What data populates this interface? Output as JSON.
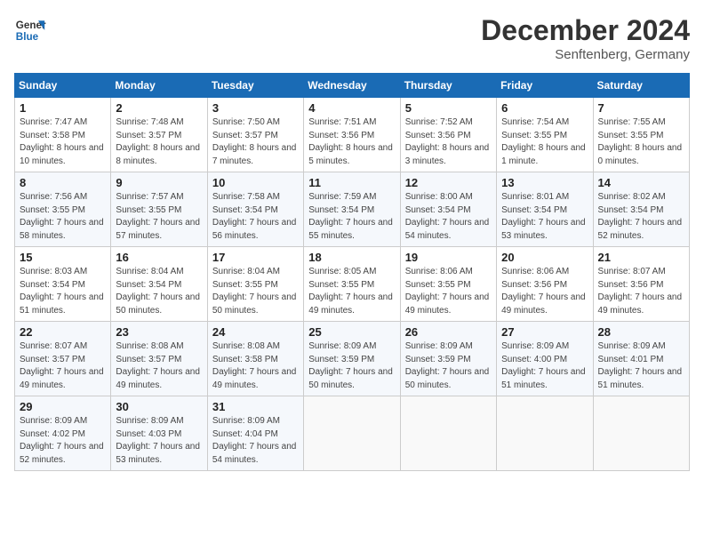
{
  "header": {
    "logo_line1": "General",
    "logo_line2": "Blue",
    "month_year": "December 2024",
    "location": "Senftenberg, Germany"
  },
  "weekdays": [
    "Sunday",
    "Monday",
    "Tuesday",
    "Wednesday",
    "Thursday",
    "Friday",
    "Saturday"
  ],
  "weeks": [
    [
      {
        "day": "1",
        "sunrise": "7:47 AM",
        "sunset": "3:58 PM",
        "daylight": "8 hours and 10 minutes."
      },
      {
        "day": "2",
        "sunrise": "7:48 AM",
        "sunset": "3:57 PM",
        "daylight": "8 hours and 8 minutes."
      },
      {
        "day": "3",
        "sunrise": "7:50 AM",
        "sunset": "3:57 PM",
        "daylight": "8 hours and 7 minutes."
      },
      {
        "day": "4",
        "sunrise": "7:51 AM",
        "sunset": "3:56 PM",
        "daylight": "8 hours and 5 minutes."
      },
      {
        "day": "5",
        "sunrise": "7:52 AM",
        "sunset": "3:56 PM",
        "daylight": "8 hours and 3 minutes."
      },
      {
        "day": "6",
        "sunrise": "7:54 AM",
        "sunset": "3:55 PM",
        "daylight": "8 hours and 1 minute."
      },
      {
        "day": "7",
        "sunrise": "7:55 AM",
        "sunset": "3:55 PM",
        "daylight": "8 hours and 0 minutes."
      }
    ],
    [
      {
        "day": "8",
        "sunrise": "7:56 AM",
        "sunset": "3:55 PM",
        "daylight": "7 hours and 58 minutes."
      },
      {
        "day": "9",
        "sunrise": "7:57 AM",
        "sunset": "3:55 PM",
        "daylight": "7 hours and 57 minutes."
      },
      {
        "day": "10",
        "sunrise": "7:58 AM",
        "sunset": "3:54 PM",
        "daylight": "7 hours and 56 minutes."
      },
      {
        "day": "11",
        "sunrise": "7:59 AM",
        "sunset": "3:54 PM",
        "daylight": "7 hours and 55 minutes."
      },
      {
        "day": "12",
        "sunrise": "8:00 AM",
        "sunset": "3:54 PM",
        "daylight": "7 hours and 54 minutes."
      },
      {
        "day": "13",
        "sunrise": "8:01 AM",
        "sunset": "3:54 PM",
        "daylight": "7 hours and 53 minutes."
      },
      {
        "day": "14",
        "sunrise": "8:02 AM",
        "sunset": "3:54 PM",
        "daylight": "7 hours and 52 minutes."
      }
    ],
    [
      {
        "day": "15",
        "sunrise": "8:03 AM",
        "sunset": "3:54 PM",
        "daylight": "7 hours and 51 minutes."
      },
      {
        "day": "16",
        "sunrise": "8:04 AM",
        "sunset": "3:54 PM",
        "daylight": "7 hours and 50 minutes."
      },
      {
        "day": "17",
        "sunrise": "8:04 AM",
        "sunset": "3:55 PM",
        "daylight": "7 hours and 50 minutes."
      },
      {
        "day": "18",
        "sunrise": "8:05 AM",
        "sunset": "3:55 PM",
        "daylight": "7 hours and 49 minutes."
      },
      {
        "day": "19",
        "sunrise": "8:06 AM",
        "sunset": "3:55 PM",
        "daylight": "7 hours and 49 minutes."
      },
      {
        "day": "20",
        "sunrise": "8:06 AM",
        "sunset": "3:56 PM",
        "daylight": "7 hours and 49 minutes."
      },
      {
        "day": "21",
        "sunrise": "8:07 AM",
        "sunset": "3:56 PM",
        "daylight": "7 hours and 49 minutes."
      }
    ],
    [
      {
        "day": "22",
        "sunrise": "8:07 AM",
        "sunset": "3:57 PM",
        "daylight": "7 hours and 49 minutes."
      },
      {
        "day": "23",
        "sunrise": "8:08 AM",
        "sunset": "3:57 PM",
        "daylight": "7 hours and 49 minutes."
      },
      {
        "day": "24",
        "sunrise": "8:08 AM",
        "sunset": "3:58 PM",
        "daylight": "7 hours and 49 minutes."
      },
      {
        "day": "25",
        "sunrise": "8:09 AM",
        "sunset": "3:59 PM",
        "daylight": "7 hours and 50 minutes."
      },
      {
        "day": "26",
        "sunrise": "8:09 AM",
        "sunset": "3:59 PM",
        "daylight": "7 hours and 50 minutes."
      },
      {
        "day": "27",
        "sunrise": "8:09 AM",
        "sunset": "4:00 PM",
        "daylight": "7 hours and 51 minutes."
      },
      {
        "day": "28",
        "sunrise": "8:09 AM",
        "sunset": "4:01 PM",
        "daylight": "7 hours and 51 minutes."
      }
    ],
    [
      {
        "day": "29",
        "sunrise": "8:09 AM",
        "sunset": "4:02 PM",
        "daylight": "7 hours and 52 minutes."
      },
      {
        "day": "30",
        "sunrise": "8:09 AM",
        "sunset": "4:03 PM",
        "daylight": "7 hours and 53 minutes."
      },
      {
        "day": "31",
        "sunrise": "8:09 AM",
        "sunset": "4:04 PM",
        "daylight": "7 hours and 54 minutes."
      },
      null,
      null,
      null,
      null
    ]
  ],
  "labels": {
    "sunrise": "Sunrise:",
    "sunset": "Sunset:",
    "daylight": "Daylight:"
  }
}
